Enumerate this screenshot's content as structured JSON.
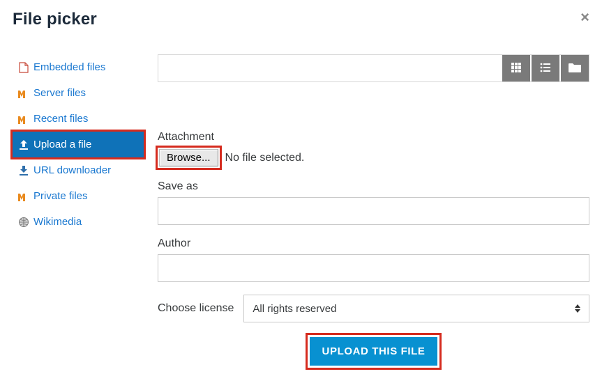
{
  "dialog": {
    "title": "File picker",
    "close_glyph": "×"
  },
  "sidebar": {
    "items": [
      {
        "label": "Embedded files",
        "icon": "embedded"
      },
      {
        "label": "Server files",
        "icon": "m-orange"
      },
      {
        "label": "Recent files",
        "icon": "m-orange"
      },
      {
        "label": "Upload a file",
        "icon": "upload",
        "active": true
      },
      {
        "label": "URL downloader",
        "icon": "download"
      },
      {
        "label": "Private files",
        "icon": "m-orange"
      },
      {
        "label": "Wikimedia",
        "icon": "globe"
      }
    ]
  },
  "form": {
    "attachment_label": "Attachment",
    "browse_label": "Browse...",
    "no_file_text": "No file selected.",
    "save_as_label": "Save as",
    "save_as_value": "",
    "author_label": "Author",
    "author_value": "",
    "license_label": "Choose license",
    "license_selected": "All rights reserved",
    "upload_button": "UPLOAD THIS FILE"
  }
}
